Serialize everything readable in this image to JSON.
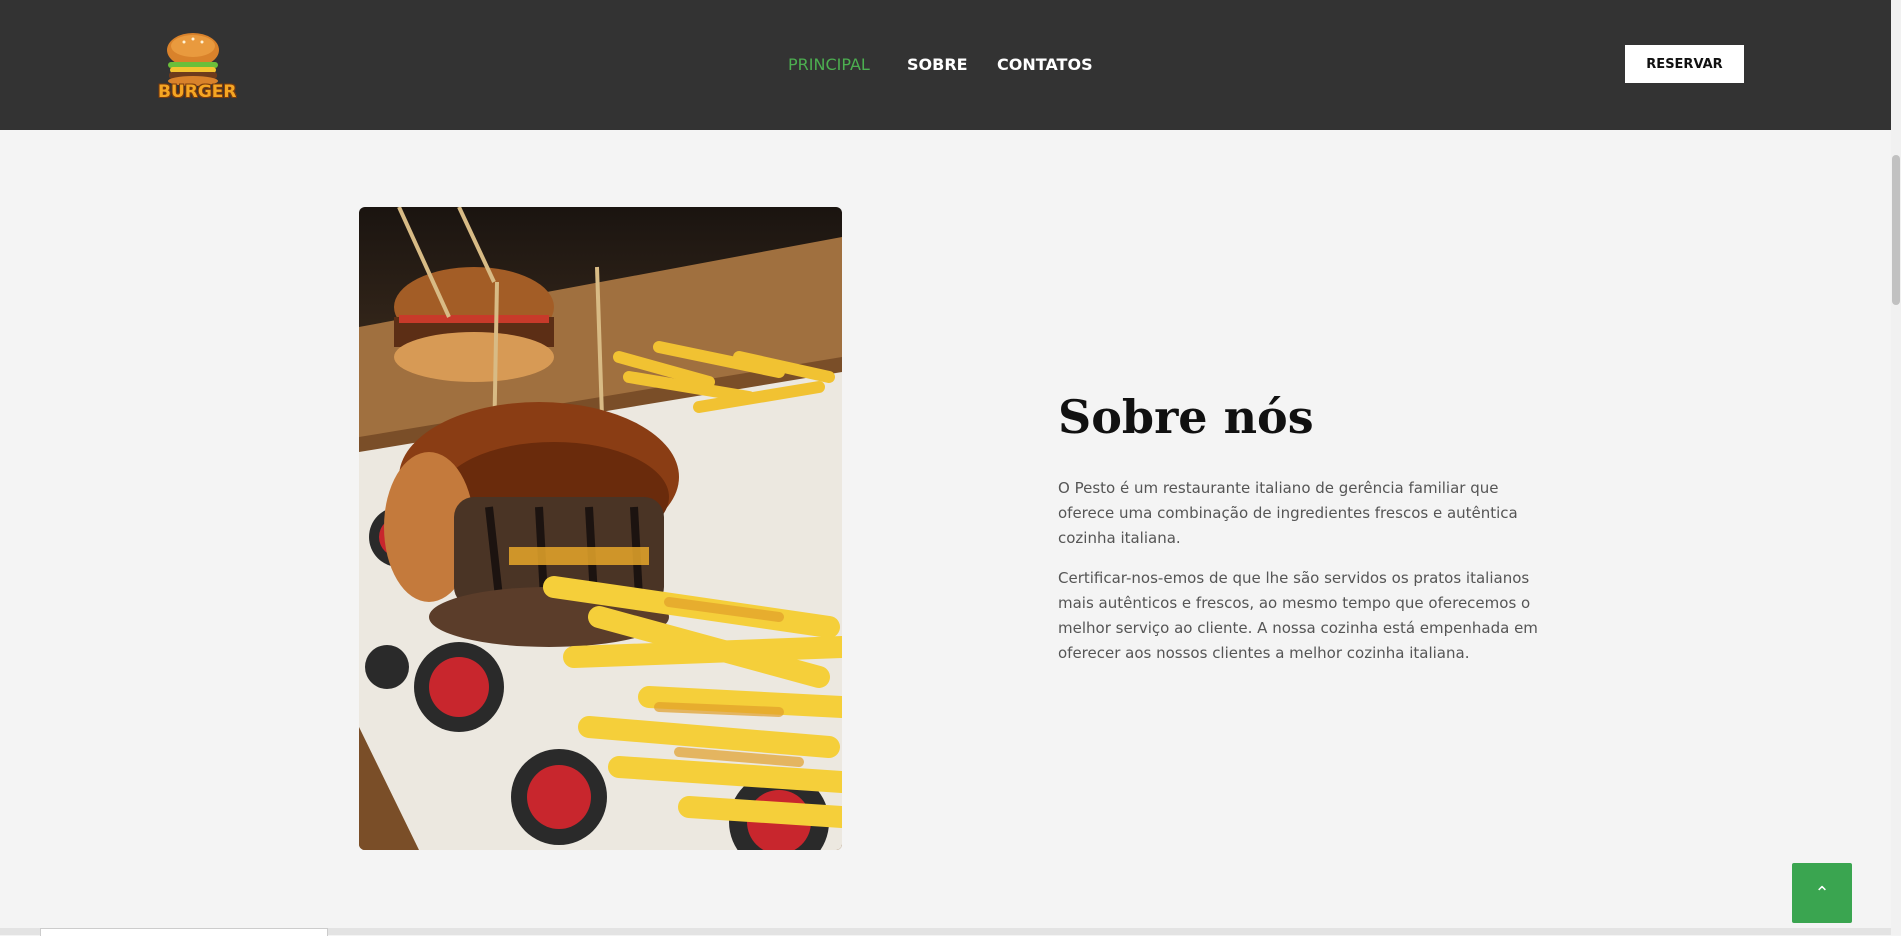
{
  "header": {
    "logo_text": "BURGER",
    "nav": [
      "PRINCIPAL",
      "SOBRE",
      "CONTATOS"
    ],
    "active_nav": "PRINCIPAL",
    "reserve_label": "RESERVAR"
  },
  "about": {
    "title": "Sobre nós",
    "paragraphs": [
      "O Pesto é um restaurante italiano de gerência familiar que oferece uma combinação de ingredientes frescos e autêntica cozinha italiana.",
      "Certificar-nos-emos de que lhe são servidos os pratos italianos mais autênticos e frescos, ao mesmo tempo que oferecemos o melhor serviço ao cliente. A nossa cozinha está empenhada em oferecer aos nossos clientes a melhor cozinha italiana."
    ]
  },
  "scroll_top": {
    "icon": "chevron-up-icon",
    "glyph": "⌃"
  },
  "colors": {
    "header_bg": "#333333",
    "accent": "#4caf50",
    "scroll_top_bg": "#3aa550",
    "page_bg": "#f4f4f4"
  }
}
